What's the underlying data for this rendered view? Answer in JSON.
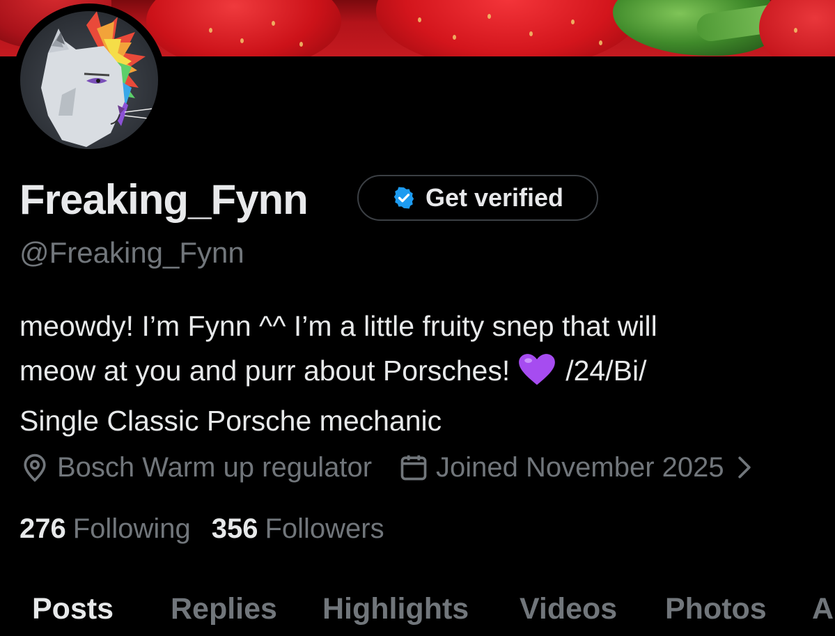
{
  "profile": {
    "display_name": "Freaking_Fynn",
    "handle": "@Freaking_Fynn",
    "verify_button_label": "Get verified",
    "bio_line1": "meowdy! I’m Fynn ^^ I’m a little fruity snep that will",
    "bio_line2_pre": "meow at you and purr about Porsches!",
    "bio_line2_post": "/24/Bi/",
    "bio_line3": "Single Classic Porsche mechanic",
    "bio_emoji": "purple-heart",
    "location": "Bosch Warm up regulator",
    "joined": "Joined November 2025",
    "following_count": "276",
    "following_label": "Following",
    "followers_count": "356",
    "followers_label": "Followers"
  },
  "tabs": [
    {
      "label": "Posts",
      "active": true
    },
    {
      "label": "Replies",
      "active": false
    },
    {
      "label": "Highlights",
      "active": false
    },
    {
      "label": "Videos",
      "active": false
    },
    {
      "label": "Photos",
      "active": false
    },
    {
      "label": "A",
      "active": false
    }
  ],
  "icons": {
    "verify": "verified-badge-icon",
    "location": "location-pin-icon",
    "calendar": "calendar-icon",
    "chevron": "chevron-right-icon"
  },
  "colors": {
    "background": "#000000",
    "primary_text": "#e7e9ea",
    "secondary_text": "#71767b",
    "verified_blue": "#1d9bf0",
    "heart_purple": "#a64cf0"
  }
}
